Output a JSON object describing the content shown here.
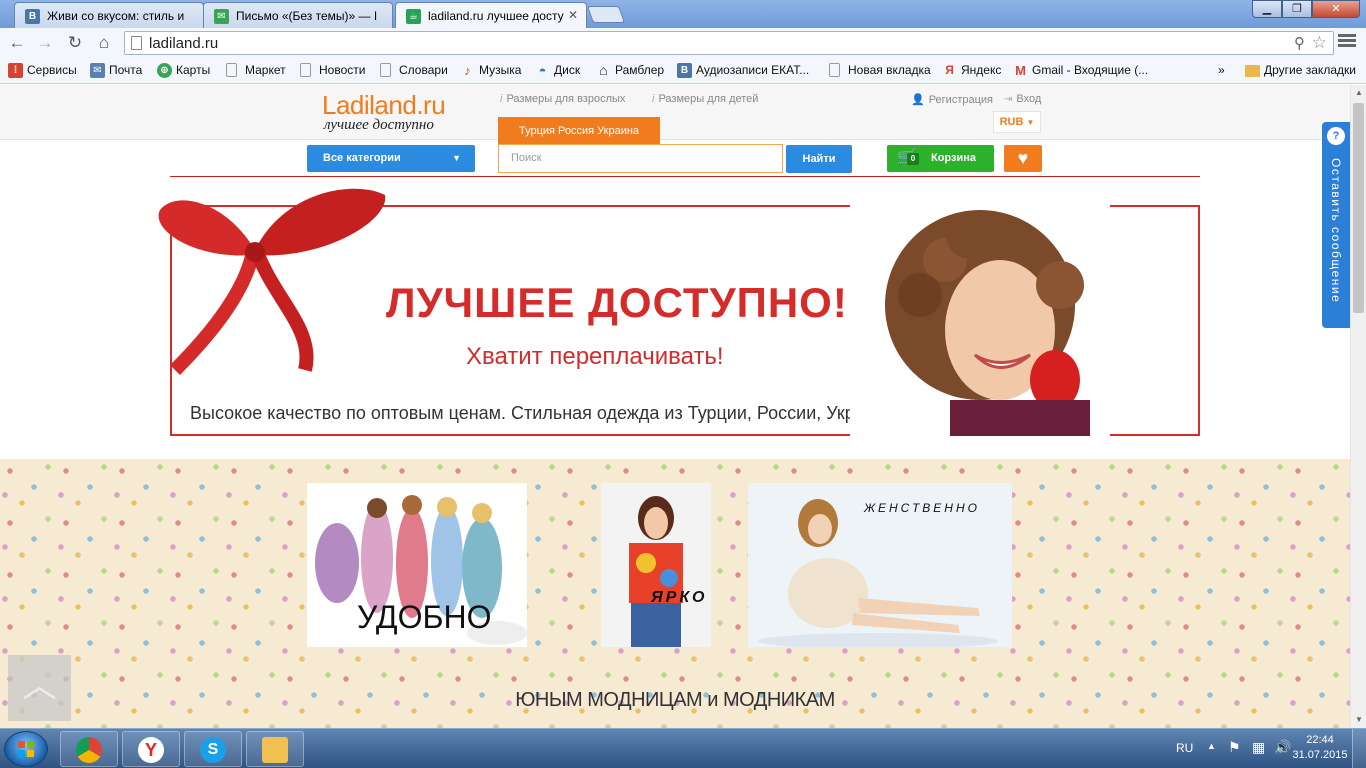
{
  "browser": {
    "tabs": [
      {
        "title": "Живи со вкусом: стиль и",
        "icon_text": "В",
        "icon_color": "#4a76a8"
      },
      {
        "title": "Письмо «(Без темы)» — I",
        "icon_text": "✉",
        "icon_color": "#3aa356"
      },
      {
        "title": "ladiland.ru лучшее досту",
        "icon_text": "☕",
        "icon_color": "#26a35a"
      }
    ],
    "url": "ladiland.ru",
    "bookmarks": [
      {
        "label": "Сервисы",
        "icon": "apps-icon",
        "color": "#d8432f"
      },
      {
        "label": "Почта",
        "icon": "mail-icon",
        "color": "#5b7fb0"
      },
      {
        "label": "Карты",
        "icon": "maps-icon",
        "color": "#3aa356"
      },
      {
        "label": "Маркет",
        "icon": "page-icon",
        "color": "#888888"
      },
      {
        "label": "Новости",
        "icon": "page-icon",
        "color": "#888888"
      },
      {
        "label": "Словари",
        "icon": "page-icon",
        "color": "#888888"
      },
      {
        "label": "Музыка",
        "icon": "music-icon",
        "color": "#d8432f"
      },
      {
        "label": "Диск",
        "icon": "disk-icon",
        "color": "#3a6fb0"
      },
      {
        "label": "Рамблер",
        "icon": "home-icon",
        "color": "#222222"
      },
      {
        "label": "Аудиозаписи ЕКАТ...",
        "icon": "vk-icon",
        "color": "#4a76a8"
      },
      {
        "label": "Новая вкладка",
        "icon": "page-icon",
        "color": "#888888"
      },
      {
        "label": "Яндекс",
        "icon": "yandex-icon",
        "color": "#d8432f"
      },
      {
        "label": "Gmail - Входящие (...",
        "icon": "gmail-icon",
        "color": "#d8432f"
      },
      {
        "label": "Другие закладки",
        "icon": "folder-icon",
        "color": "#e8b84a"
      }
    ],
    "bookmarks_overflow": "»"
  },
  "site": {
    "logo": {
      "main": "Ladiland.ru",
      "tagline": "лучшее доступно"
    },
    "top_links": {
      "sizes_adult": "Размеры для взрослых",
      "sizes_kids": "Размеры для детей",
      "register": "Регистрация",
      "login": "Вход"
    },
    "currency": "RUB",
    "country_tab": "Турция Россия Украина",
    "categories_button": "Все категории",
    "search_placeholder": "Поиск",
    "find_button": "Найти",
    "cart": {
      "label": "Корзина",
      "count": "0"
    },
    "banner": {
      "title": "ЛУЧШЕЕ ДОСТУПНО!",
      "subtitle": "Хватит переплачивать!",
      "tagline": "Высокое качество по оптовым ценам. Стильная одежда из Турции, России, Украины."
    },
    "promos": [
      {
        "label": "УДОБНО"
      },
      {
        "label": "ЯРКО"
      },
      {
        "label": "ЖЕНСТВЕННО"
      }
    ],
    "section_title": "ЮНЫМ МОДНИЦАМ и МОДНИКАМ",
    "feedback_tab": "Оставить сообщение"
  },
  "taskbar": {
    "lang": "RU",
    "time": "22:44",
    "date": "31.07.2015"
  },
  "colors": {
    "accent_orange": "#f07c1e",
    "accent_blue": "#2b8be0",
    "cart_green": "#2bb12b",
    "banner_red": "#d52b2b"
  }
}
